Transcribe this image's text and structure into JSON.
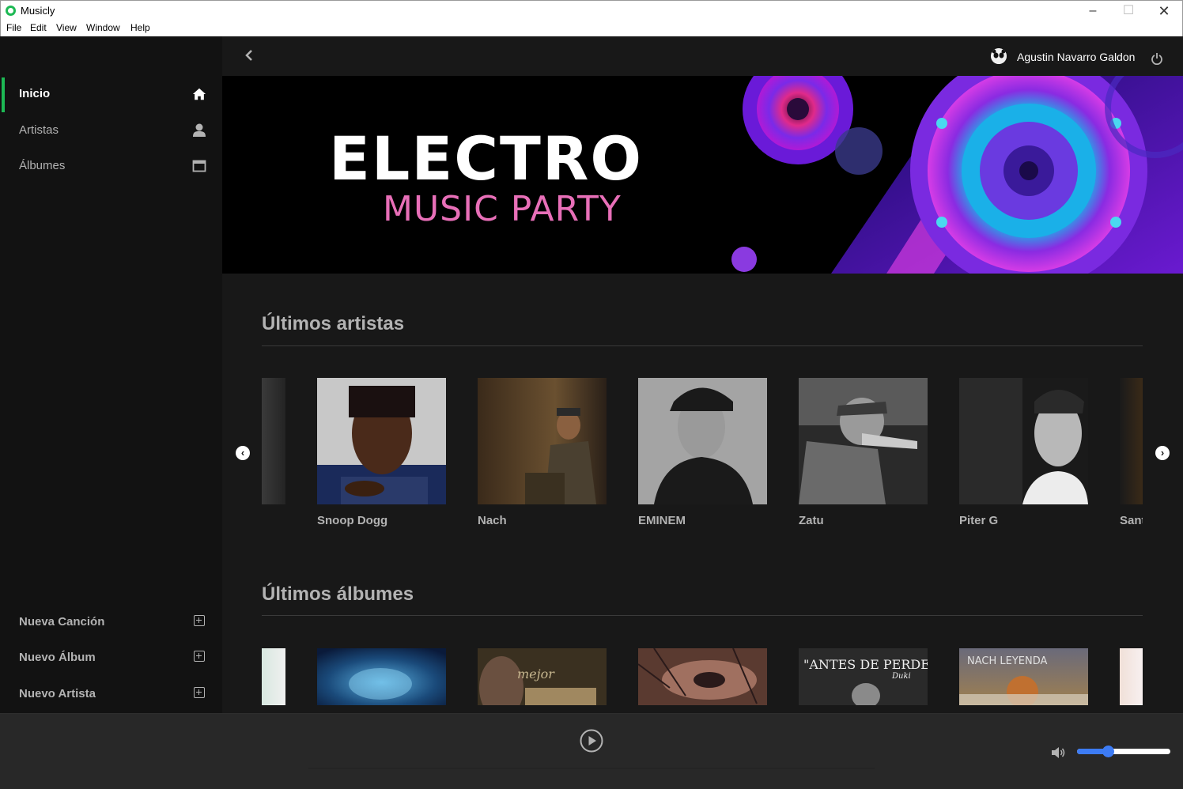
{
  "window": {
    "title": "Musicly",
    "menu": [
      "File",
      "Edit",
      "View",
      "Window",
      "Help"
    ]
  },
  "sidebar": {
    "nav": [
      {
        "label": "Inicio",
        "icon": "home-icon",
        "active": true
      },
      {
        "label": "Artistas",
        "icon": "user-icon",
        "active": false
      },
      {
        "label": "Álbumes",
        "icon": "album-icon",
        "active": false
      }
    ],
    "actions": [
      {
        "label": "Nueva Canción",
        "icon": "plus-square-icon"
      },
      {
        "label": "Nuevo Álbum",
        "icon": "plus-square-icon"
      },
      {
        "label": "Nuevo Artista",
        "icon": "plus-square-icon"
      }
    ]
  },
  "header": {
    "user_name": "Agustin Navarro Galdon"
  },
  "banner": {
    "title": "ELECTRO",
    "subtitle": "MUSIC PARTY"
  },
  "artists_section": {
    "title": "Últimos artistas",
    "items": [
      {
        "name": "Snoop Dogg"
      },
      {
        "name": "Nach"
      },
      {
        "name": "EMINEM"
      },
      {
        "name": "Zatu"
      },
      {
        "name": "Piter G"
      },
      {
        "name": "Sant"
      }
    ]
  },
  "albums_section": {
    "title": "Últimos álbumes",
    "album_texts": {
      "antes": "\"ANTES DE PERDERTE\"",
      "duki": "Duki",
      "nach_leyenda": "NACH    LEYENDA",
      "mejor": "mejor"
    }
  },
  "player": {
    "volume": 0.33
  },
  "colors": {
    "accent": "#1db954",
    "volume": "#3d7cf5",
    "background": "#181818",
    "sidebar": "#121212",
    "player": "#282828"
  }
}
